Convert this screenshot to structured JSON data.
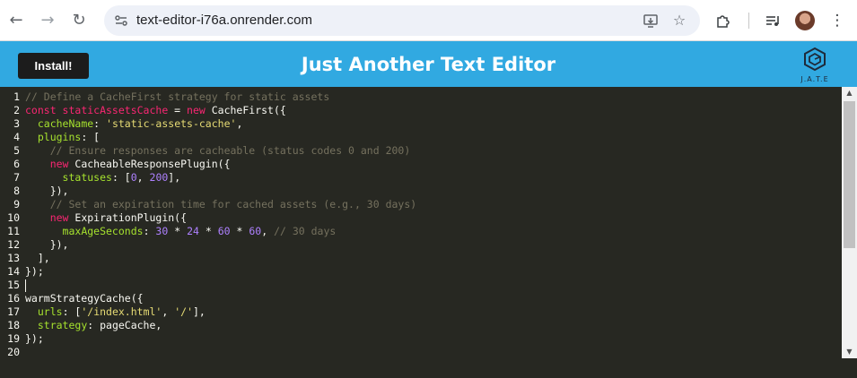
{
  "browser": {
    "url": "text-editor-i76a.onrender.com",
    "icons": [
      "back-arrow-icon",
      "forward-arrow-icon",
      "reload-icon",
      "site-settings-icon",
      "install-app-icon",
      "bookmark-star-icon",
      "extensions-icon",
      "media-icon",
      "profile-avatar-icon",
      "more-menu-icon"
    ]
  },
  "app": {
    "install_label": "Install!",
    "title": "Just Another Text Editor",
    "logo_text": "J.A.T.E",
    "header_color": "#31a9e1"
  },
  "editor": {
    "lines": [
      {
        "n": "1",
        "tokens": [
          {
            "t": "cm",
            "v": "// Define a CacheFirst strategy for static assets"
          }
        ]
      },
      {
        "n": "2",
        "tokens": [
          {
            "t": "kw",
            "v": "const "
          },
          {
            "t": "var",
            "v": "staticAssetsCache"
          },
          {
            "t": "pl",
            "v": " = "
          },
          {
            "t": "kw",
            "v": "new "
          },
          {
            "t": "pl",
            "v": "CacheFirst({"
          }
        ]
      },
      {
        "n": "3",
        "tokens": [
          {
            "t": "pl",
            "v": "  "
          },
          {
            "t": "prop",
            "v": "cacheName"
          },
          {
            "t": "pl",
            "v": ": "
          },
          {
            "t": "str",
            "v": "'static-assets-cache'"
          },
          {
            "t": "pl",
            "v": ","
          }
        ]
      },
      {
        "n": "4",
        "tokens": [
          {
            "t": "pl",
            "v": "  "
          },
          {
            "t": "prop",
            "v": "plugins"
          },
          {
            "t": "pl",
            "v": ": ["
          }
        ]
      },
      {
        "n": "5",
        "tokens": [
          {
            "t": "pl",
            "v": "    "
          },
          {
            "t": "cm",
            "v": "// Ensure responses are cacheable (status codes 0 and 200)"
          }
        ]
      },
      {
        "n": "6",
        "tokens": [
          {
            "t": "pl",
            "v": "    "
          },
          {
            "t": "kw",
            "v": "new "
          },
          {
            "t": "pl",
            "v": "CacheableResponsePlugin({"
          }
        ]
      },
      {
        "n": "7",
        "tokens": [
          {
            "t": "pl",
            "v": "      "
          },
          {
            "t": "prop",
            "v": "statuses"
          },
          {
            "t": "pl",
            "v": ": ["
          },
          {
            "t": "num",
            "v": "0"
          },
          {
            "t": "pl",
            "v": ", "
          },
          {
            "t": "num",
            "v": "200"
          },
          {
            "t": "pl",
            "v": "],"
          }
        ]
      },
      {
        "n": "8",
        "tokens": [
          {
            "t": "pl",
            "v": "    }),"
          }
        ]
      },
      {
        "n": "9",
        "tokens": [
          {
            "t": "pl",
            "v": "    "
          },
          {
            "t": "cm",
            "v": "// Set an expiration time for cached assets (e.g., 30 days)"
          }
        ]
      },
      {
        "n": "10",
        "tokens": [
          {
            "t": "pl",
            "v": "    "
          },
          {
            "t": "kw",
            "v": "new "
          },
          {
            "t": "pl",
            "v": "ExpirationPlugin({"
          }
        ]
      },
      {
        "n": "11",
        "tokens": [
          {
            "t": "pl",
            "v": "      "
          },
          {
            "t": "prop",
            "v": "maxAgeSeconds"
          },
          {
            "t": "pl",
            "v": ": "
          },
          {
            "t": "num",
            "v": "30"
          },
          {
            "t": "pl",
            "v": " * "
          },
          {
            "t": "num",
            "v": "24"
          },
          {
            "t": "pl",
            "v": " * "
          },
          {
            "t": "num",
            "v": "60"
          },
          {
            "t": "pl",
            "v": " * "
          },
          {
            "t": "num",
            "v": "60"
          },
          {
            "t": "pl",
            "v": ", "
          },
          {
            "t": "cm",
            "v": "// 30 days"
          }
        ]
      },
      {
        "n": "12",
        "tokens": [
          {
            "t": "pl",
            "v": "    }),"
          }
        ]
      },
      {
        "n": "13",
        "tokens": [
          {
            "t": "pl",
            "v": "  ],"
          }
        ]
      },
      {
        "n": "14",
        "tokens": [
          {
            "t": "pl",
            "v": "});"
          }
        ]
      },
      {
        "n": "15",
        "tokens": [],
        "cursor": true
      },
      {
        "n": "16",
        "tokens": [
          {
            "t": "pl",
            "v": "warmStrategyCache({"
          }
        ]
      },
      {
        "n": "17",
        "tokens": [
          {
            "t": "pl",
            "v": "  "
          },
          {
            "t": "prop",
            "v": "urls"
          },
          {
            "t": "pl",
            "v": ": ["
          },
          {
            "t": "str",
            "v": "'/index.html'"
          },
          {
            "t": "pl",
            "v": ", "
          },
          {
            "t": "str",
            "v": "'/'"
          },
          {
            "t": "pl",
            "v": "],"
          }
        ]
      },
      {
        "n": "18",
        "tokens": [
          {
            "t": "pl",
            "v": "  "
          },
          {
            "t": "prop",
            "v": "strategy"
          },
          {
            "t": "pl",
            "v": ": pageCache,"
          }
        ]
      },
      {
        "n": "19",
        "tokens": [
          {
            "t": "pl",
            "v": "});"
          }
        ]
      },
      {
        "n": "20",
        "tokens": []
      }
    ],
    "scroll_position_fraction": 0
  }
}
